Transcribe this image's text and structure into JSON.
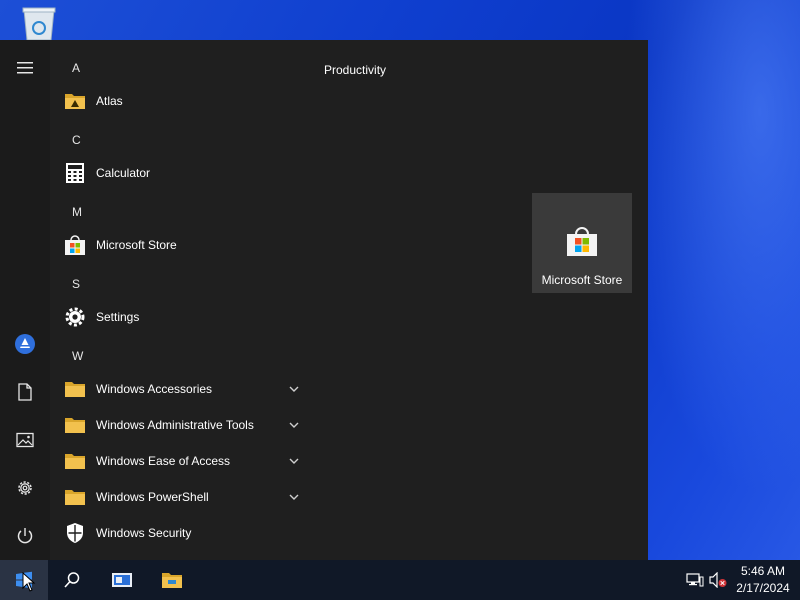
{
  "desktop": {
    "recycle_bin_icon": "recycle-bin-icon"
  },
  "start_menu": {
    "rail": [
      {
        "name": "expand-menu",
        "icon": "hamburger-icon"
      },
      {
        "name": "user-account",
        "icon": "atlas-avatar-icon"
      },
      {
        "name": "documents",
        "icon": "document-icon"
      },
      {
        "name": "pictures",
        "icon": "pictures-icon"
      },
      {
        "name": "settings",
        "icon": "gear-icon"
      },
      {
        "name": "power",
        "icon": "power-icon"
      }
    ],
    "letters": [
      "A",
      "C",
      "M",
      "S",
      "W"
    ],
    "apps": [
      {
        "label": "Atlas",
        "icon": "folder-atlas-icon"
      },
      {
        "label": "Calculator",
        "icon": "calculator-icon"
      },
      {
        "label": "Microsoft Store",
        "icon": "store-icon"
      },
      {
        "label": "Settings",
        "icon": "gear-icon"
      },
      {
        "label": "Windows Accessories",
        "icon": "folder-icon",
        "expandable": true
      },
      {
        "label": "Windows Administrative Tools",
        "icon": "folder-icon",
        "expandable": true
      },
      {
        "label": "Windows Ease of Access",
        "icon": "folder-icon",
        "expandable": true
      },
      {
        "label": "Windows PowerShell",
        "icon": "folder-icon",
        "expandable": true
      },
      {
        "label": "Windows Security",
        "icon": "shield-icon"
      }
    ],
    "group_title": "Productivity",
    "tile": {
      "label": "Microsoft Store",
      "icon": "store-icon"
    }
  },
  "taskbar": {
    "buttons": [
      {
        "name": "start",
        "icon": "windows-logo-icon"
      },
      {
        "name": "search",
        "icon": "search-icon"
      },
      {
        "name": "task-view",
        "icon": "task-view-icon"
      },
      {
        "name": "file-explorer",
        "icon": "file-explorer-icon"
      }
    ],
    "tray": [
      {
        "name": "network",
        "icon": "network-icon"
      },
      {
        "name": "volume",
        "icon": "volume-muted-icon"
      }
    ],
    "clock": {
      "time": "5:46 AM",
      "date": "2/17/2024"
    }
  },
  "colors": {
    "menu_bg": "#1f1f1f",
    "tile_bg": "#3a3a3a",
    "taskbar_bg": "#101827",
    "folder_yellow": "#f2c14e",
    "accent_blue": "#2f6fdc"
  }
}
